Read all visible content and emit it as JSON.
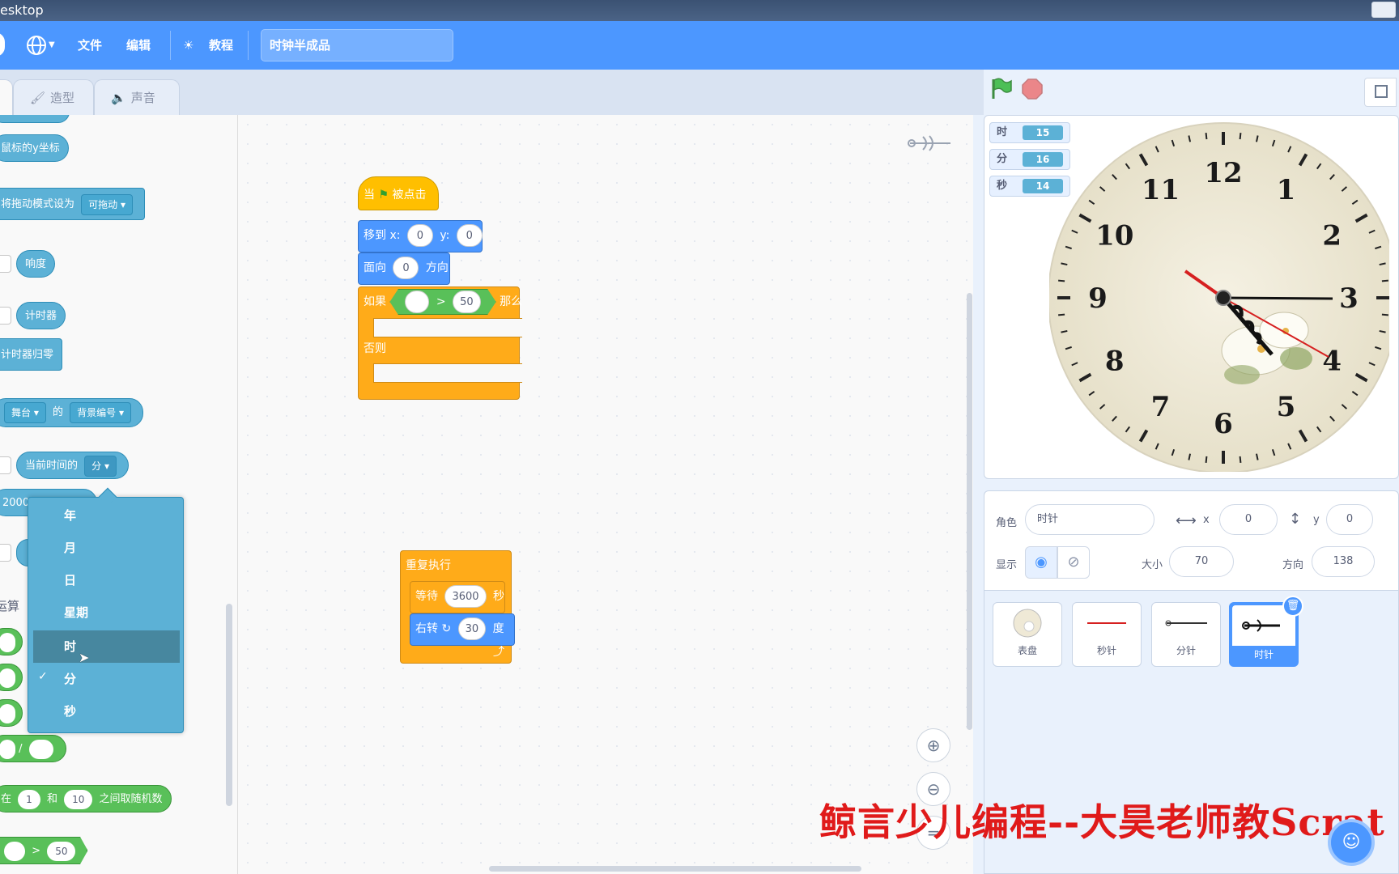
{
  "window": {
    "title": "esktop"
  },
  "menubar": {
    "file": "文件",
    "edit": "编辑",
    "tutorials": "教程",
    "project_title": "时钟半成品"
  },
  "tabs": {
    "costumes": "造型",
    "sounds": "声音"
  },
  "palette": {
    "mouse_y": "鼠标的y坐标",
    "drag_mode": "将拖动模式设为",
    "drag_mode_value": "可拖动",
    "loudness": "响度",
    "timer": "计时器",
    "reset_timer": "计时器归零",
    "of_target": "舞台",
    "of_word": "的",
    "of_attr": "背景编号",
    "current_prefix": "当前时间的",
    "current_value": "分",
    "days_since": "2000",
    "operators_title": "运算",
    "divide": "/",
    "random_pre": "在",
    "random_from": "1",
    "random_and": "和",
    "random_to": "10",
    "random_post": "之间取随机数",
    "gt_sign": ">",
    "gt_value": "50"
  },
  "dropdown": {
    "options": [
      "年",
      "月",
      "日",
      "星期",
      "时",
      "分",
      "秒"
    ],
    "highlighted": "时",
    "checked": "分",
    "check_mark": "✓"
  },
  "script1": {
    "hat_when": "当",
    "hat_clicked": "被点击",
    "goto_label": "移到 x:",
    "goto_x": "0",
    "goto_y_label": "y:",
    "goto_y": "0",
    "point_label": "面向",
    "point_value": "0",
    "point_suffix": "方向",
    "if_label": "如果",
    "if_op": ">",
    "if_value": "50",
    "if_then": "那么",
    "else_label": "否则"
  },
  "script2": {
    "forever": "重复执行",
    "wait_label": "等待",
    "wait_value": "3600",
    "wait_unit": "秒",
    "turn_label": "右转",
    "turn_value": "30",
    "turn_unit": "度"
  },
  "stage": {
    "monitors": [
      {
        "label": "时",
        "value": "15"
      },
      {
        "label": "分",
        "value": "16"
      },
      {
        "label": "秒",
        "value": "14"
      }
    ],
    "clock_numbers": [
      "12",
      "1",
      "2",
      "3",
      "4",
      "5",
      "6",
      "7",
      "8",
      "9",
      "10",
      "11"
    ]
  },
  "sprite_info": {
    "sprite_label": "角色",
    "sprite_name": "时针",
    "x_label": "x",
    "x_value": "0",
    "y_label": "y",
    "y_value": "0",
    "show_label": "显示",
    "size_label": "大小",
    "size_value": "70",
    "direction_label": "方向",
    "direction_value": "138"
  },
  "sprites": [
    {
      "name": "表盘",
      "selected": false
    },
    {
      "name": "秒针",
      "selected": false
    },
    {
      "name": "分针",
      "selected": false
    },
    {
      "name": "时针",
      "selected": true
    }
  ],
  "watermark": "鲸言少儿编程--大昊老师教Scrat",
  "colors": {
    "accent": "#4c97ff",
    "sensing": "#5cb1d6",
    "operators": "#59c059",
    "control": "#ffab19",
    "events": "#ffbf00",
    "motion": "#4c97ff",
    "watermark": "#e01a1a"
  }
}
